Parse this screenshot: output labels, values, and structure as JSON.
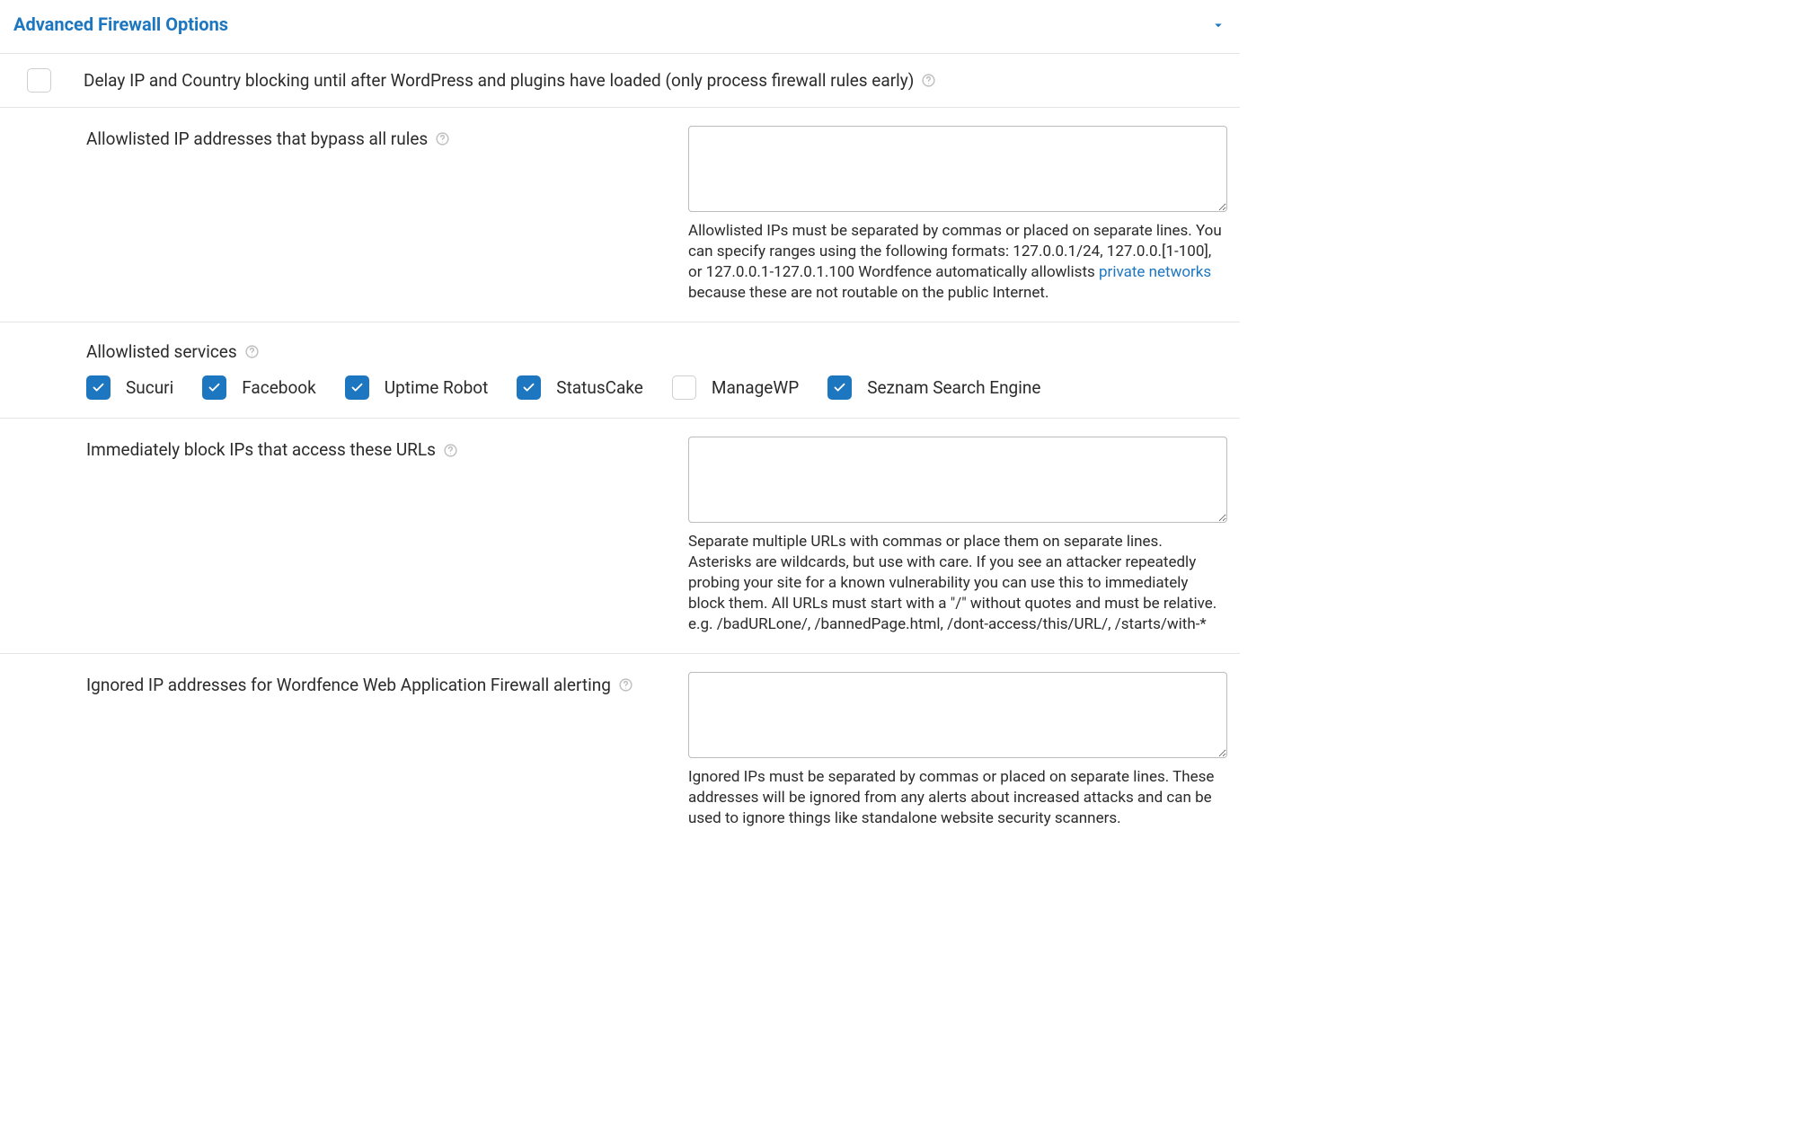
{
  "section": {
    "title": "Advanced Firewall Options",
    "collapse_icon": "chevron-down"
  },
  "delay_ip_blocking": {
    "label": "Delay IP and Country blocking until after WordPress and plugins have loaded (only process firewall rules early)",
    "checked": false
  },
  "allowlisted_ips": {
    "label": "Allowlisted IP addresses that bypass all rules",
    "value": "",
    "help_before_link": "Allowlisted IPs must be separated by commas or placed on separate lines. You can specify ranges using the following formats: 127.0.0.1/24, 127.0.0.[1-100], or 127.0.0.1-127.0.1.100 Wordfence automatically allowlists ",
    "help_link_text": "private networks",
    "help_after_link": " because these are not routable on the public Internet."
  },
  "allowlisted_services": {
    "label": "Allowlisted services",
    "items": [
      {
        "name": "sucuri",
        "label": "Sucuri",
        "checked": true
      },
      {
        "name": "facebook",
        "label": "Facebook",
        "checked": true
      },
      {
        "name": "uptime-robot",
        "label": "Uptime Robot",
        "checked": true
      },
      {
        "name": "statuscake",
        "label": "StatusCake",
        "checked": true
      },
      {
        "name": "managewp",
        "label": "ManageWP",
        "checked": false
      },
      {
        "name": "seznam",
        "label": "Seznam Search Engine",
        "checked": true
      }
    ]
  },
  "block_urls": {
    "label": "Immediately block IPs that access these URLs",
    "value": "",
    "help": "Separate multiple URLs with commas or place them on separate lines. Asterisks are wildcards, but use with care. If you see an attacker repeatedly probing your site for a known vulnerability you can use this to immediately block them. All URLs must start with a \"/\" without quotes and must be relative. e.g. /badURLone/, /bannedPage.html, /dont-access/this/URL/, /starts/with-*"
  },
  "ignored_ips": {
    "label": "Ignored IP addresses for Wordfence Web Application Firewall alerting",
    "value": "",
    "help": "Ignored IPs must be separated by commas or placed on separate lines. These addresses will be ignored from any alerts about increased attacks and can be used to ignore things like standalone website security scanners."
  }
}
